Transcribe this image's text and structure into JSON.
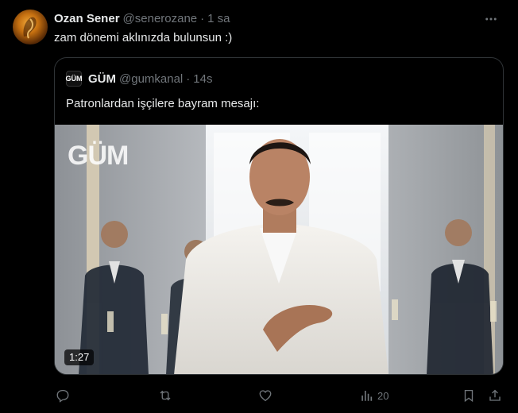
{
  "tweet": {
    "author_name": "Ozan Sener",
    "author_handle": "@senerozane",
    "separator": "·",
    "time": "1 sa",
    "text": "zam dönemi aklınızda bulunsun :)",
    "more_icon": "more-dots-icon"
  },
  "quoted": {
    "logo_text": "GÜM",
    "author_name": "GÜM",
    "author_handle": "@gumkanal",
    "separator": "·",
    "time": "14s",
    "text": "Patronlardan işçilere bayram mesajı:",
    "media": {
      "watermark": "GÜM",
      "duration": "1:27"
    }
  },
  "actions": {
    "reply_icon": "reply-icon",
    "retweet_icon": "retweet-icon",
    "like_icon": "heart-icon",
    "views_icon": "views-icon",
    "views_count": "20",
    "bookmark_icon": "bookmark-icon",
    "share_icon": "share-icon"
  },
  "colors": {
    "background": "#000000",
    "text_primary": "#e7e9ea",
    "text_secondary": "#71767b",
    "border": "#2f3336"
  }
}
